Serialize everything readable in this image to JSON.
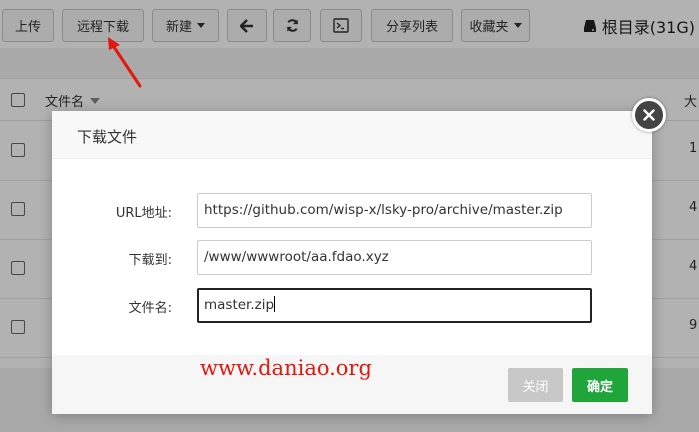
{
  "toolbar": {
    "upload_label": "上传",
    "remote_download_label": "远程下载",
    "new_label": "新建",
    "share_list_label": "分享列表",
    "favorites_label": "收藏夹",
    "root_label": "根目录(31G)"
  },
  "file_table": {
    "name_header": "文件名",
    "size_header": "大",
    "rows": [
      {
        "size": "1"
      },
      {
        "size": "4"
      },
      {
        "size": "4"
      },
      {
        "size": "9"
      }
    ]
  },
  "modal": {
    "title": "下载文件",
    "url_label": "URL地址:",
    "url_value": "https://github.com/wisp-x/lsky-pro/archive/master.zip",
    "dest_label": "下载到:",
    "dest_value": "/www/wwwroot/aa.fdao.xyz",
    "filename_label": "文件名:",
    "filename_value": "master.zip",
    "close_label": "关闭",
    "confirm_label": "确定"
  },
  "watermark": "www.daniao.org",
  "colors": {
    "confirm_green": "#20a53a",
    "annotation_red": "#e3170d"
  }
}
